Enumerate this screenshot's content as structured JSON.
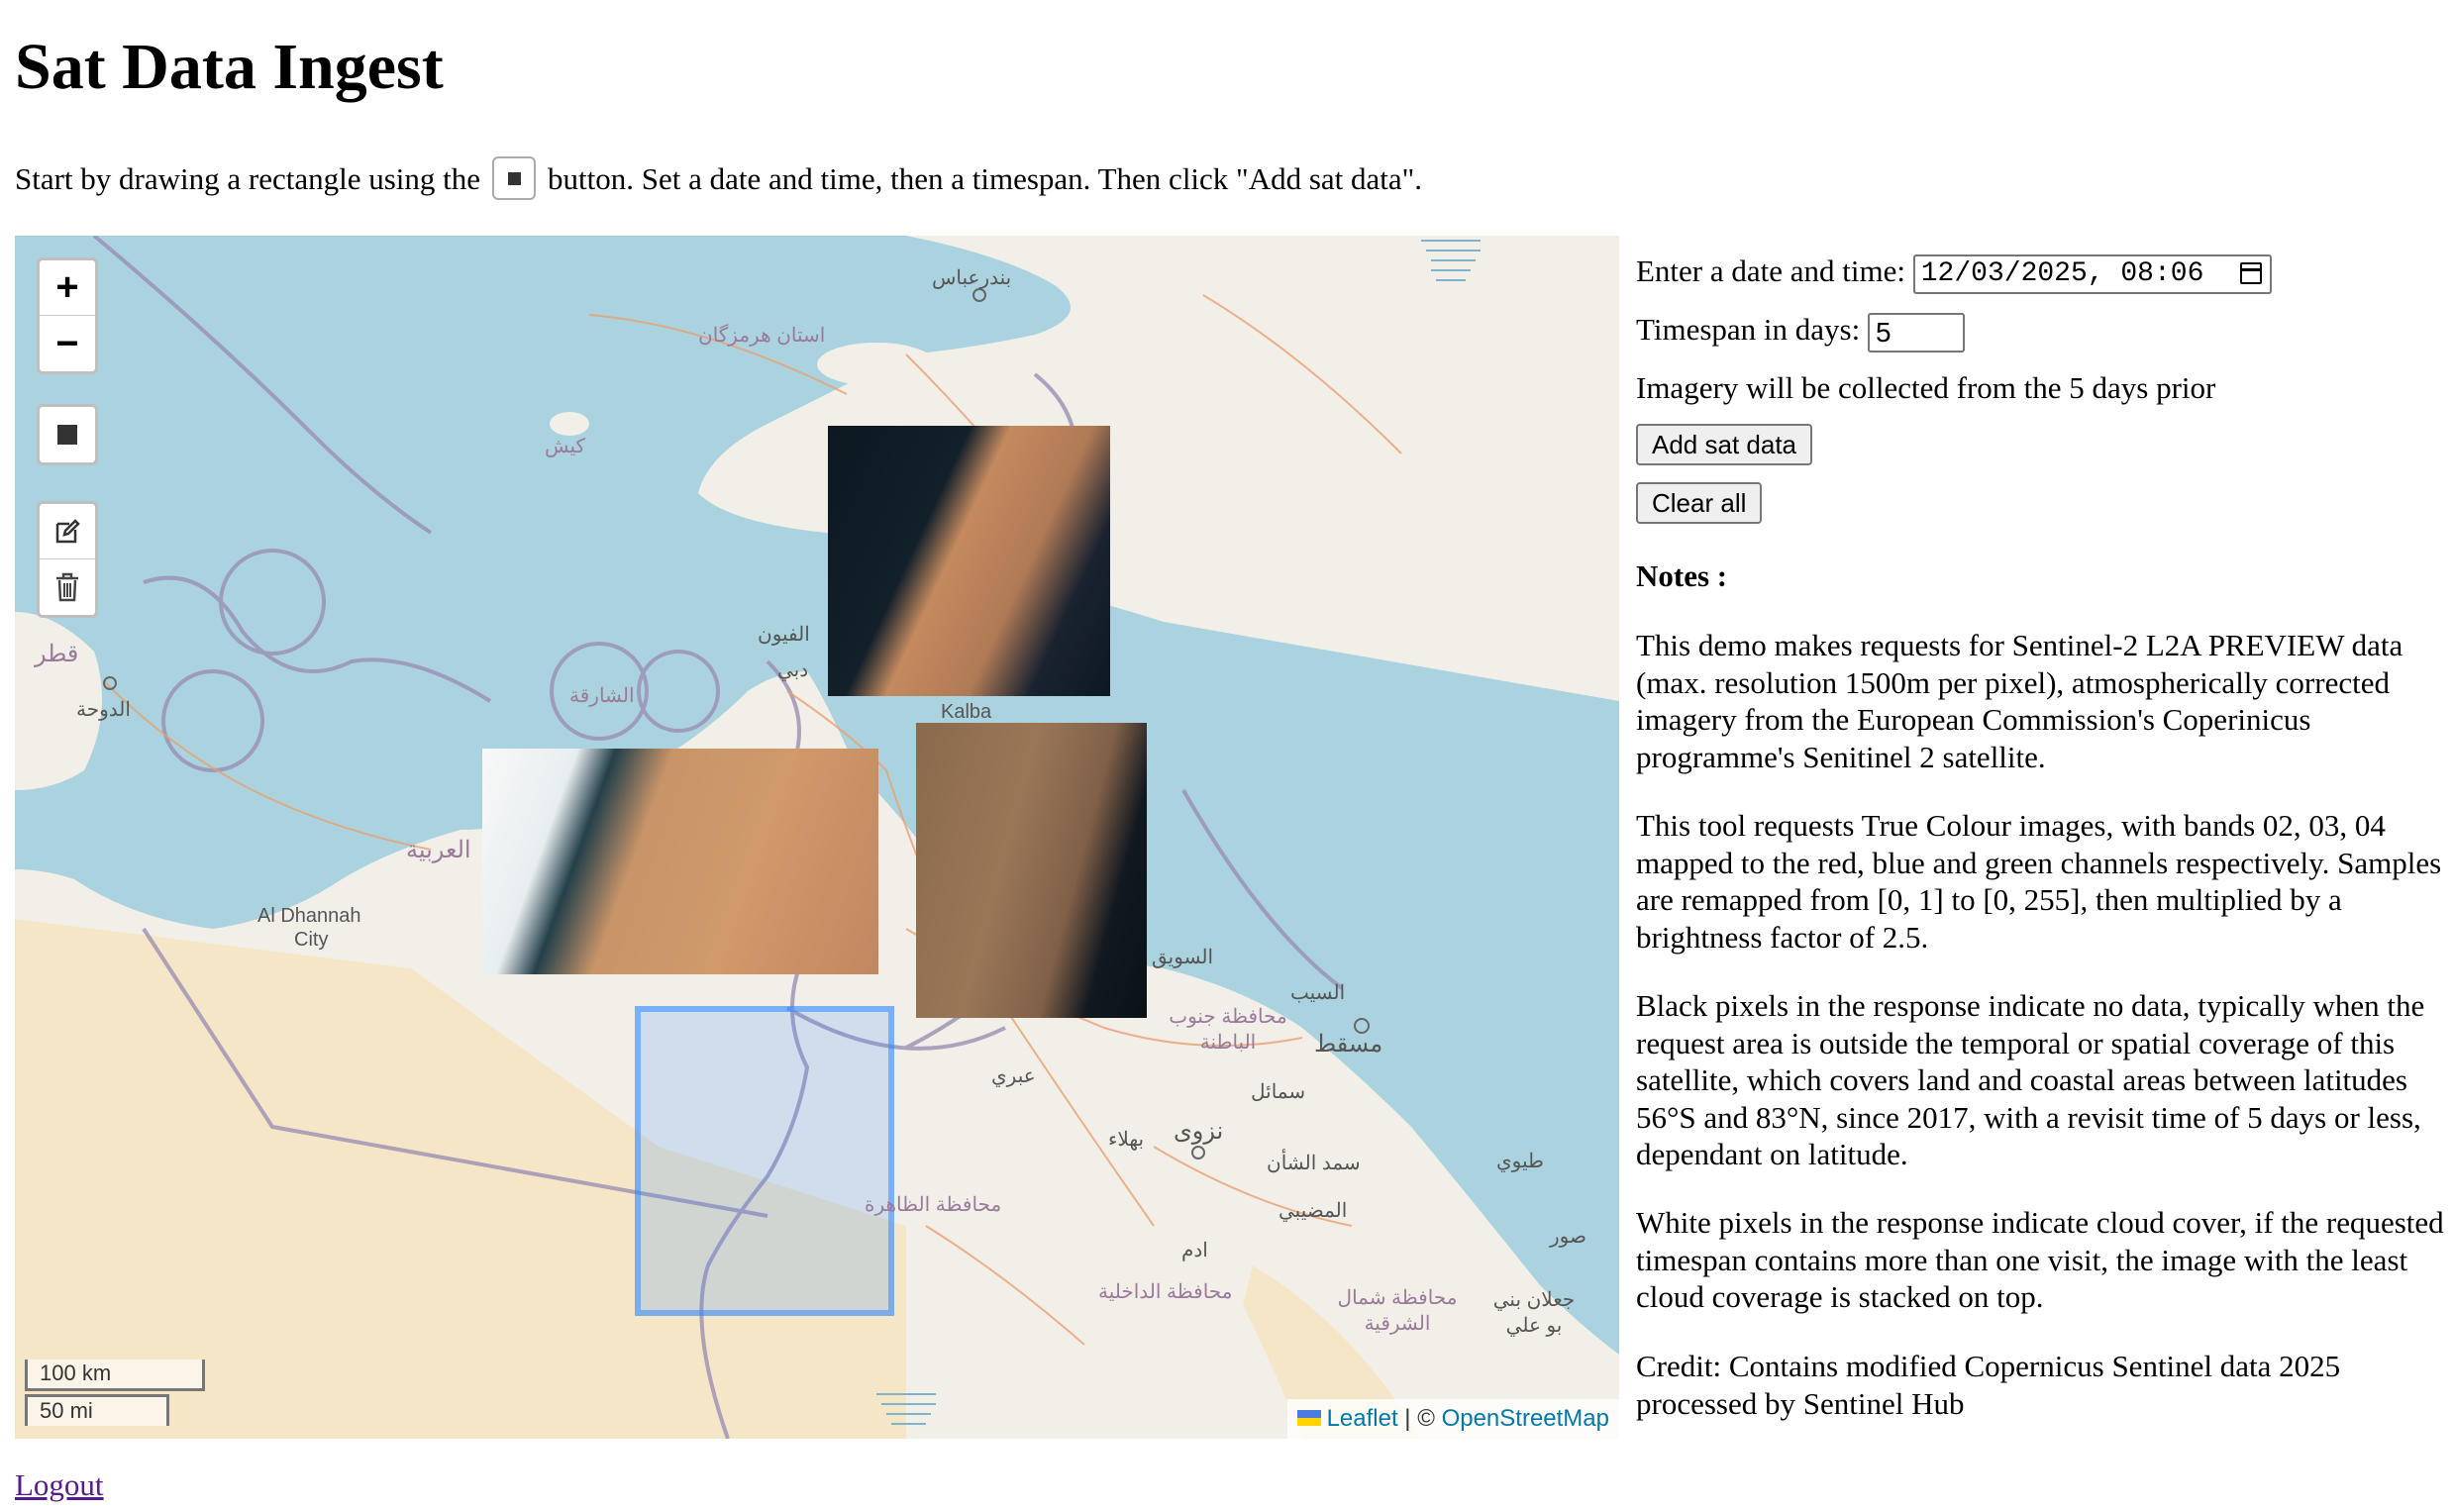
{
  "page": {
    "title": "Sat Data Ingest",
    "intro_before": "Start by drawing a rectangle using the",
    "intro_after": "button. Set a date and time, then a timespan. Then click \"Add sat data\"."
  },
  "map": {
    "zoom_in": "+",
    "zoom_out": "−",
    "scale_metric": "100 km",
    "scale_imperial": "50 mi",
    "attribution_leaflet": "Leaflet",
    "attribution_sep": "| ©",
    "attribution_osm": "OpenStreetMap",
    "labels": {
      "bandar_abbas": "بندرعباس",
      "hormozgan": "استان هرمزگان",
      "kish": "کیش",
      "qatar": "قطر",
      "doha": "الدوحة",
      "sharjah": "الشارقة",
      "al_fuyun": "الفيون",
      "dubai": "دبي",
      "arabia": "العربية",
      "al_dhannah": "Al Dhannah",
      "city": "City",
      "kalba": "Kalba",
      "suwaiq": "السويق",
      "batinah": "محافظة جنوب الباطنة",
      "seeb": "السيب",
      "muscat": "مسقط",
      "ibri": "عبري",
      "bahla": "بهلاء",
      "nizwa": "نزوى",
      "samail": "سمائل",
      "dhahirah": "محافظة الظاهرة",
      "sahan": "سمد الشأن",
      "tiwi": "طيوي",
      "mudaybi": "المضيبي",
      "adam": "ادم",
      "sur": "صور",
      "dakhiliyah": "محافظة الداخلية",
      "sharqiyah": "محافظة شمال الشرقية",
      "jaalan": "جعلان بني بو علي"
    }
  },
  "form": {
    "date_label": "Enter a date and time:",
    "date_value": "12/03/2025, 08:06",
    "timespan_label": "Timespan in days:",
    "timespan_value": "5",
    "info": "Imagery will be collected from the 5 days prior",
    "add_button": "Add sat data",
    "clear_button": "Clear all"
  },
  "notes": {
    "title": "Notes :",
    "p1": "This demo makes requests for Sentinel-2 L2A PREVIEW data (max. resolution 1500m per pixel), atmospherically corrected imagery from the European Commission's Coperinicus programme's Senitinel 2 satellite.",
    "p2": "This tool requests True Colour images, with bands 02, 03, 04 mapped to the red, blue and green channels respectively. Samples are remapped from [0, 1] to [0, 255], then multiplied by a brightness factor of 2.5.",
    "p3": "Black pixels in the response indicate no data, typically when the request area is outside the temporal or spatial coverage of this satellite, which covers land and coastal areas between latitudes 56°S and 83°N, since 2017, with a revisit time of 5 days or less, dependant on latitude.",
    "p4": "White pixels in the response indicate cloud cover, if the requested timespan contains more than one visit, the image with the least cloud coverage is stacked on top.",
    "p5": "Credit: Contains modified Copernicus Sentinel data 2025 processed by Sentinel Hub"
  },
  "footer": {
    "logout": "Logout"
  },
  "colors": {
    "sea": "#aad3df",
    "land": "#f2efe9",
    "desert": "#f5e6c8",
    "selection": "#3388ff",
    "link": "#0078a8"
  }
}
